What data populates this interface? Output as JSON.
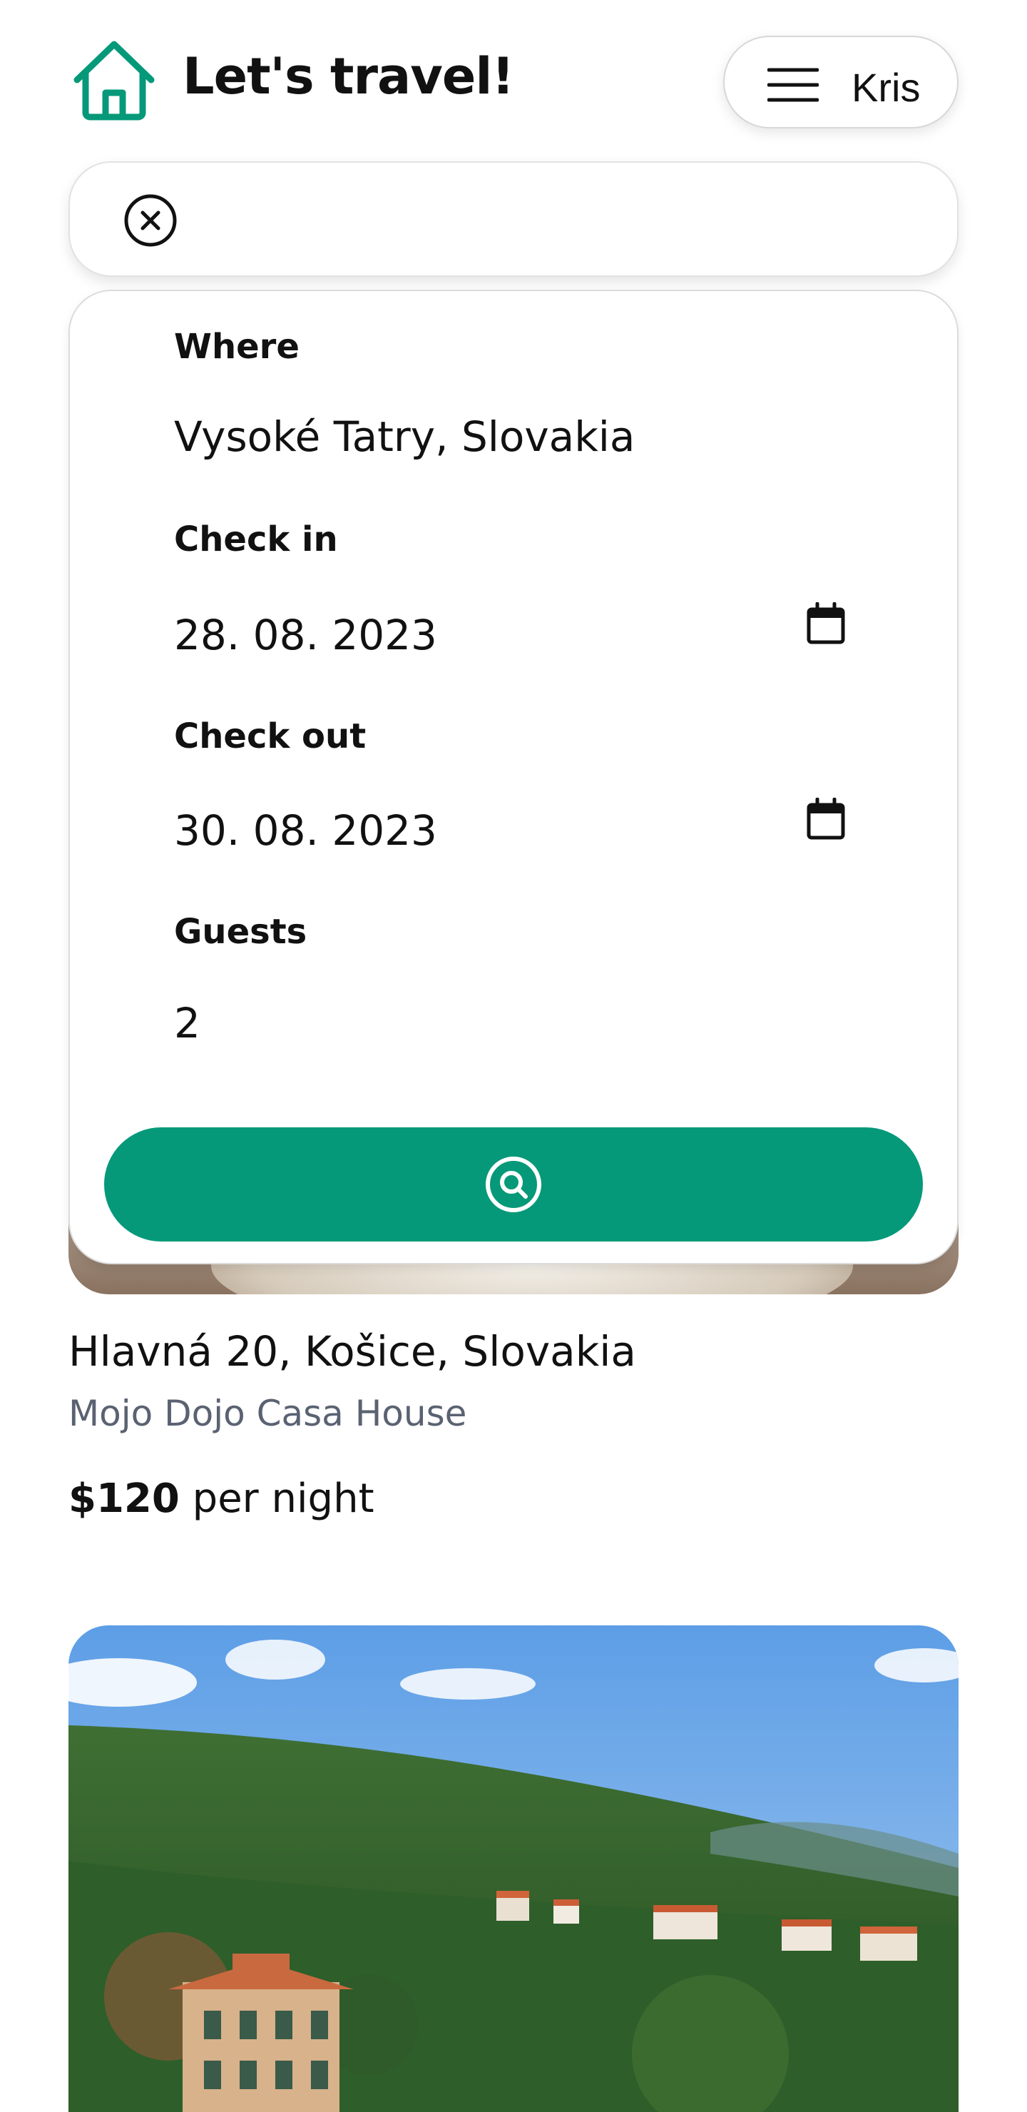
{
  "header": {
    "title": "Let's travel!",
    "user_name": "Kris"
  },
  "search": {
    "where_label": "Where",
    "where_value": "Vysoké Tatry, Slovakia",
    "checkin_label": "Check in",
    "checkin_value": "28. 08. 2023",
    "checkout_label": "Check out",
    "checkout_value": "30. 08. 2023",
    "guests_label": "Guests",
    "guests_value": "2"
  },
  "listings": [
    {
      "address": "Hlavná 20, Košice, Slovakia",
      "name": "Mojo Dojo Casa House",
      "price": "$120",
      "price_unit": "per night"
    }
  ],
  "icons": {
    "logo": "home-icon",
    "menu": "menu-icon",
    "clear": "close-circle-icon",
    "calendar": "calendar-icon",
    "search": "search-icon"
  },
  "colors": {
    "accent": "#059979",
    "muted_text": "#5a6272"
  }
}
